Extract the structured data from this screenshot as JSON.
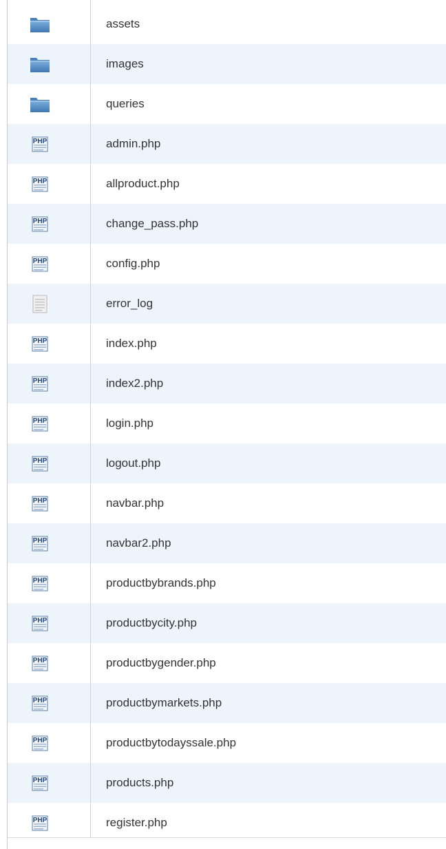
{
  "files": [
    {
      "name": "assets",
      "icon": "folder-icon"
    },
    {
      "name": "images",
      "icon": "folder-icon"
    },
    {
      "name": "queries",
      "icon": "folder-icon"
    },
    {
      "name": "admin.php",
      "icon": "php-file-icon"
    },
    {
      "name": "allproduct.php",
      "icon": "php-file-icon"
    },
    {
      "name": "change_pass.php",
      "icon": "php-file-icon"
    },
    {
      "name": "config.php",
      "icon": "php-file-icon"
    },
    {
      "name": "error_log",
      "icon": "text-file-icon"
    },
    {
      "name": "index.php",
      "icon": "php-file-icon"
    },
    {
      "name": "index2.php",
      "icon": "php-file-icon"
    },
    {
      "name": "login.php",
      "icon": "php-file-icon"
    },
    {
      "name": "logout.php",
      "icon": "php-file-icon"
    },
    {
      "name": "navbar.php",
      "icon": "php-file-icon"
    },
    {
      "name": "navbar2.php",
      "icon": "php-file-icon"
    },
    {
      "name": "productbybrands.php",
      "icon": "php-file-icon"
    },
    {
      "name": "productbycity.php",
      "icon": "php-file-icon"
    },
    {
      "name": "productbygender.php",
      "icon": "php-file-icon"
    },
    {
      "name": "productbymarkets.php",
      "icon": "php-file-icon"
    },
    {
      "name": "productbytodayssale.php",
      "icon": "php-file-icon"
    },
    {
      "name": "products.php",
      "icon": "php-file-icon"
    },
    {
      "name": "register.php",
      "icon": "php-file-icon"
    }
  ],
  "colors": {
    "row_alt": "#eef4fb",
    "folder": "#5b8fc4",
    "php_icon": "#2f5f9e"
  }
}
